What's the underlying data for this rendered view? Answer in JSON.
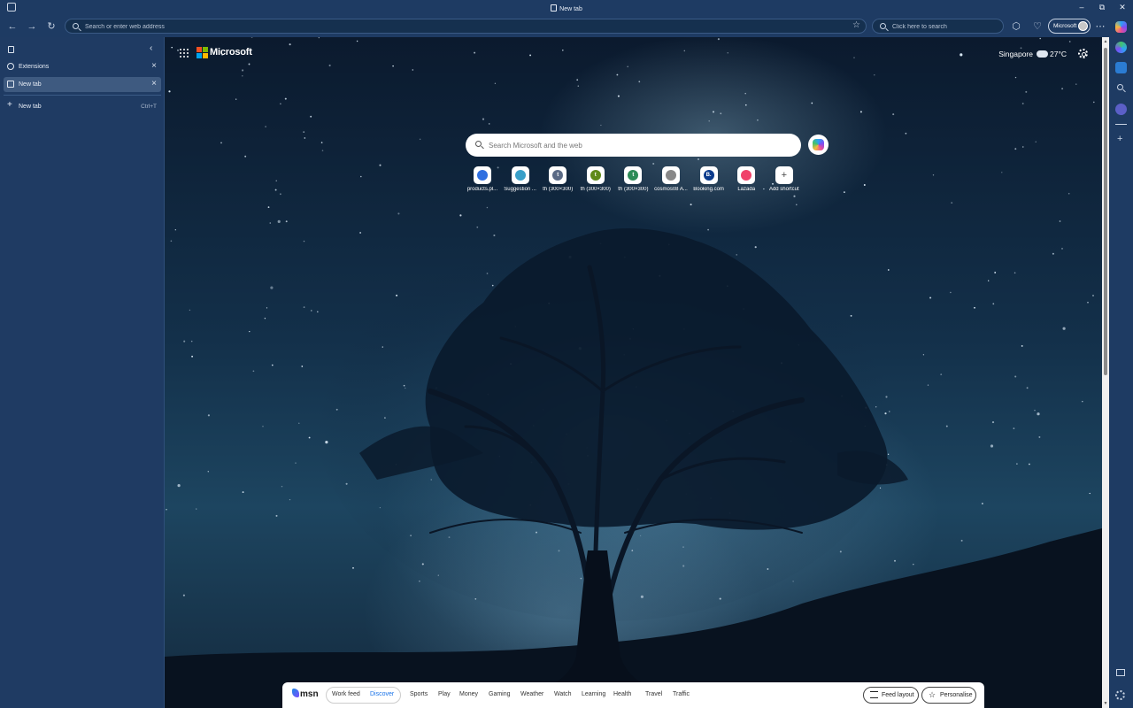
{
  "window": {
    "title": "New tab",
    "controls": {
      "minimize": "–",
      "restore": "⧉",
      "close": "✕"
    }
  },
  "toolbar": {
    "address_placeholder": "Search or enter web address",
    "search_placeholder": "Click here to search",
    "profile_label": "Microsoft"
  },
  "sidebar": {
    "tabs": [
      {
        "label": "Extensions",
        "icon": "extensions-icon",
        "active": false
      },
      {
        "label": "New tab",
        "icon": "page-icon",
        "active": true
      }
    ],
    "new_tab": {
      "label": "New tab",
      "shortcut": "Ctrl+T"
    }
  },
  "page": {
    "brand": "Microsoft",
    "weather": {
      "city": "Singapore",
      "temp": "27°C",
      "icon": "partly-cloudy-icon"
    },
    "search_placeholder": "Search Microsoft and the web",
    "shortcuts": [
      {
        "label": "products.pl...",
        "icon": "blue-shield-icon",
        "color": "#2f6fe0",
        "letter": ""
      },
      {
        "label": "Suggestion ...",
        "icon": "suggestion-icon",
        "color": "#39a0c9",
        "letter": ""
      },
      {
        "label": "th (300×300)",
        "icon": "letter-tile-icon",
        "color": "#5a6a85",
        "letter": "t"
      },
      {
        "label": "th (300×300)",
        "icon": "letter-tile-icon",
        "color": "#5f8a1a",
        "letter": "t"
      },
      {
        "label": "th (300×300)",
        "icon": "letter-tile-icon",
        "color": "#2e8b57",
        "letter": "t"
      },
      {
        "label": "cosmos08 A...",
        "icon": "cosmos-icon",
        "color": "#888888",
        "letter": ""
      },
      {
        "label": "Booking.com",
        "icon": "booking-icon",
        "color": "#0b3b8c",
        "letter": "B."
      },
      {
        "label": "Lazada",
        "icon": "lazada-heart-icon",
        "color": "#f0426a",
        "letter": ""
      },
      {
        "label": "Add shortcut",
        "icon": "plus-icon",
        "color": "#ffffff",
        "letter": "+"
      }
    ]
  },
  "msn": {
    "logo": "msn",
    "toggle": {
      "work": "Work feed",
      "discover": "Discover"
    },
    "nav": [
      "Sports",
      "Play",
      "Money",
      "Gaming",
      "Weather",
      "Watch",
      "Learning",
      "Health",
      "Travel",
      "Traffic"
    ],
    "feed_layout": "Feed layout",
    "personalise": "Personalise"
  },
  "colors": {
    "accent": "#1e3b63",
    "link_active": "#1a73e8"
  }
}
